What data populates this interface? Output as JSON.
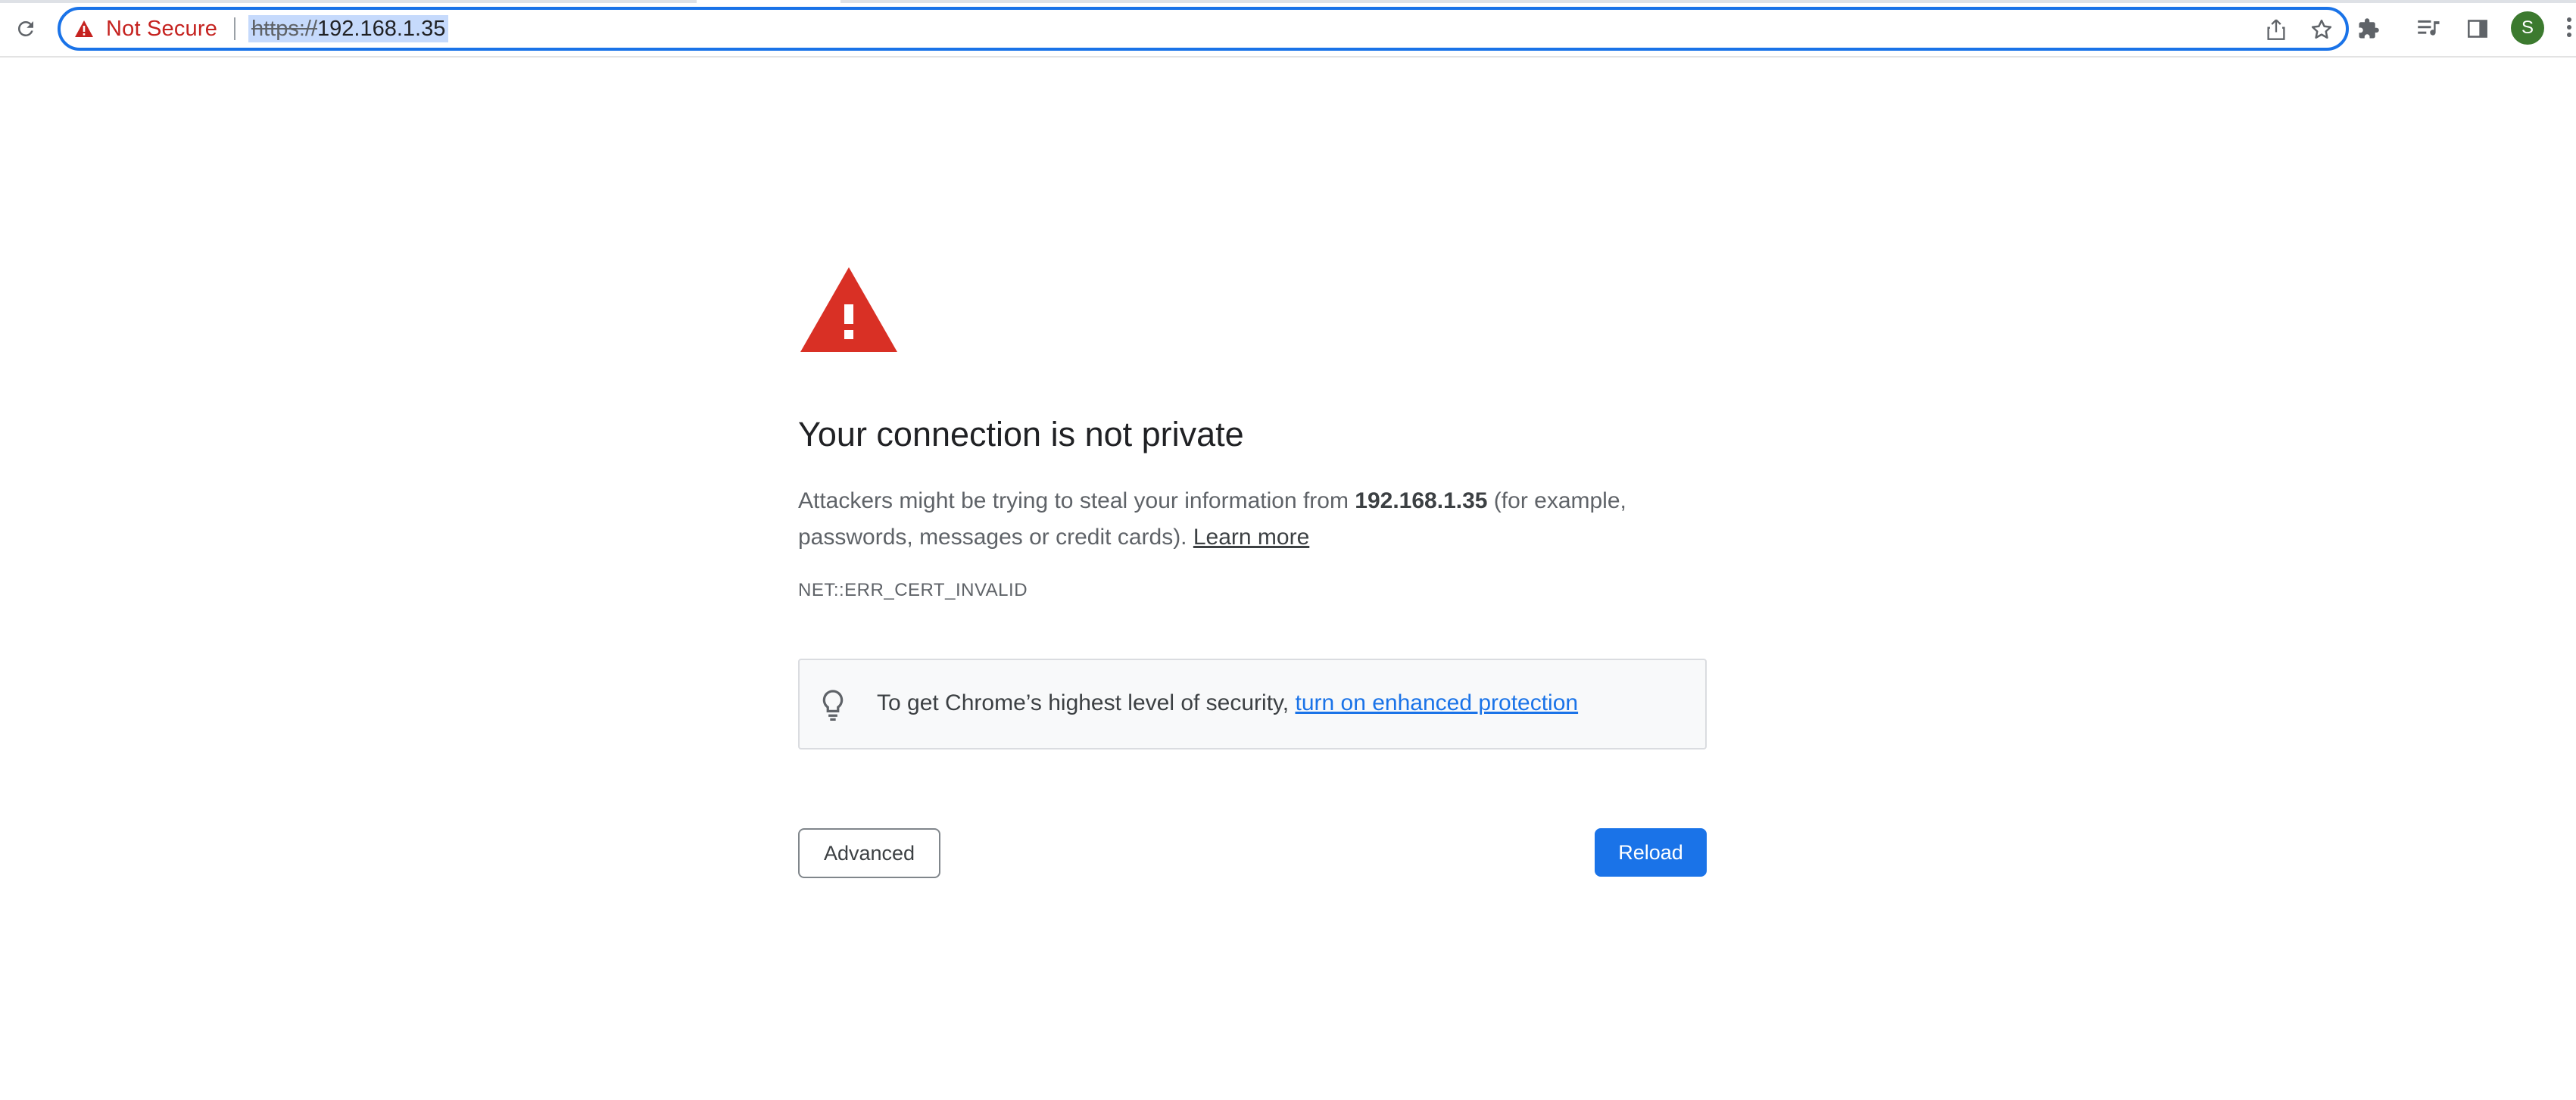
{
  "toolbar": {
    "security_label": "Not Secure",
    "url_scheme": "https://",
    "url_host": "192.168.1.35",
    "profile_initial": "S",
    "icons": [
      "reload-icon",
      "warning-icon",
      "share-icon",
      "bookmark-star-icon",
      "extensions-icon",
      "media-control-icon",
      "side-panel-icon",
      "more-menu-icon"
    ]
  },
  "interstitial": {
    "title": "Your connection is not private",
    "message_pre": "Attackers might be trying to steal your information from ",
    "message_host": "192.168.1.35",
    "message_post": " (for example, passwords, messages or credit cards). ",
    "learn_more": "Learn more",
    "error_code": "NET::ERR_CERT_INVALID",
    "enhanced_text": "To get Chrome’s highest level of security, ",
    "enhanced_link": "turn on enhanced protection",
    "advanced_label": "Advanced",
    "reload_label": "Reload"
  },
  "colors": {
    "accent": "#1a73e8",
    "danger": "#c5221f",
    "warning_triangle": "#d93025"
  }
}
